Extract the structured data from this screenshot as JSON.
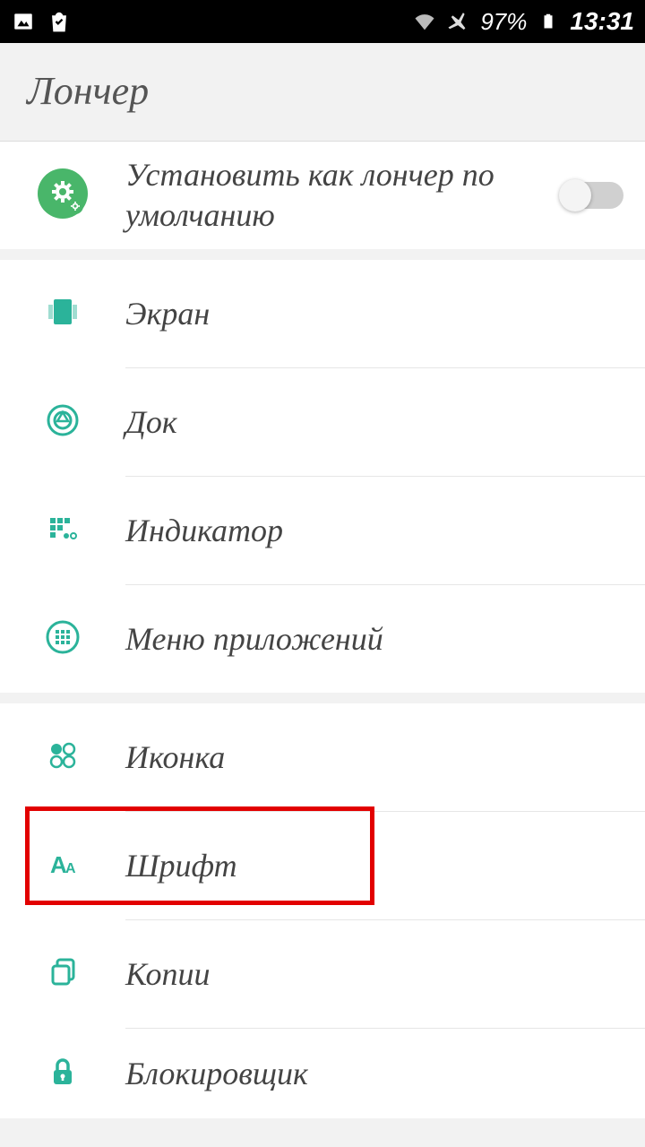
{
  "status": {
    "battery_pct": "97%",
    "time": "13:31"
  },
  "header": {
    "title": "Лончер"
  },
  "default_launcher": {
    "label": "Установить как лончер по умолчанию"
  },
  "items1": [
    {
      "key": "screen",
      "label": "Экран"
    },
    {
      "key": "dock",
      "label": "Док"
    },
    {
      "key": "indicator",
      "label": "Индикатор"
    },
    {
      "key": "appmenu",
      "label": "Меню приложений"
    }
  ],
  "items2": [
    {
      "key": "icon",
      "label": "Иконка"
    },
    {
      "key": "font",
      "label": "Шрифт",
      "highlighted": true
    },
    {
      "key": "copies",
      "label": "Копии"
    },
    {
      "key": "blocker",
      "label": "Блокировщик"
    }
  ],
  "colors": {
    "accent": "#2bb39a"
  }
}
